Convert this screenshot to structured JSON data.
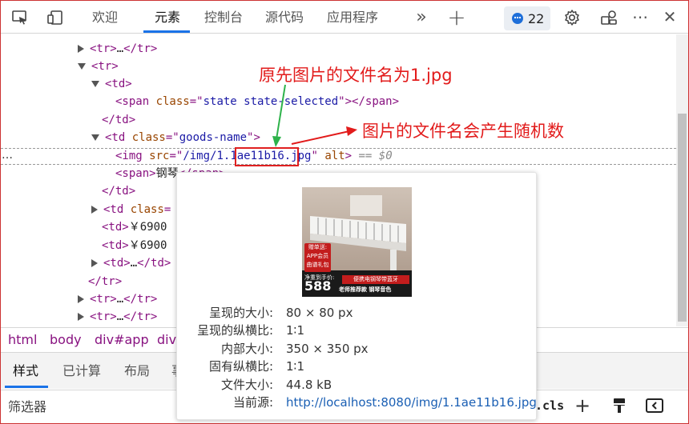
{
  "toolbar": {
    "tabs": [
      {
        "label": "欢迎"
      },
      {
        "label": "元素"
      },
      {
        "label": "控制台"
      },
      {
        "label": "源代码"
      },
      {
        "label": "应用程序"
      }
    ],
    "issues_count": "22",
    "more_tabs_glyph": "»",
    "add_glyph": "+",
    "overflow_glyph": "⋯",
    "close_glyph": "✕"
  },
  "dom_tree": {
    "lines": [
      {
        "pre": "",
        "tag_open": "<tr>",
        "mid": "…",
        "tag_close": "</tr>"
      },
      {
        "tag": "<tr>"
      },
      {
        "tag": "<td>"
      },
      {
        "tag_a": "<span ",
        "attr": "class",
        "eq": "=\"",
        "val": "state state-selected",
        "q": "\">",
        "tag_b": "</span>"
      },
      {
        "tag": "</td>"
      },
      {
        "tag_a": "<td ",
        "attr": "class",
        "eq": "=\"",
        "val": "goods-name",
        "q": "\">"
      },
      {
        "tag_a": "<img ",
        "attr": "src",
        "eq": "=\"",
        "val_a": "/img/1.",
        "val_hl": "1ae11b16",
        "val_b": ".jpg",
        "q": "\" ",
        "attr2": "alt",
        "tag_b": ">",
        "eq_dollar": " == $0"
      },
      {
        "tag_a": "<span>",
        "text": "钢琴",
        "tag_b": "</span>"
      },
      {
        "tag": "</td>"
      },
      {
        "tag_a": "<td ",
        "attr": "class",
        "eq": "="
      },
      {
        "tag_a": "<td>",
        "text": "￥6900"
      },
      {
        "tag_a": "<td>",
        "text": "￥6900"
      },
      {
        "tag_a": "<td>",
        "mid": "…",
        "tag_b": "</td>"
      },
      {
        "tag": "</tr>"
      },
      {
        "tag_a": "<tr>",
        "mid": "…",
        "tag_b": "</tr>"
      },
      {
        "tag_a": "<tr>",
        "mid": "…",
        "tag_b": "</tr>"
      }
    ],
    "row_ellipsis": "…"
  },
  "annotations": {
    "top": "原先图片的文件名为1.jpg",
    "right": "图片的文件名会产生随机数"
  },
  "breadcrumb": [
    {
      "label": "html"
    },
    {
      "label": "body"
    },
    {
      "label": "div#app"
    },
    {
      "label": "div."
    }
  ],
  "bottom_tabs": [
    {
      "label": "样式"
    },
    {
      "label": "已计算"
    },
    {
      "label": "布局"
    },
    {
      "label": "事"
    }
  ],
  "filter": {
    "label": "筛选器",
    "cls_label": ".cls"
  },
  "tooltip": {
    "thumb_text": {
      "badge": "赠单送:",
      "badge2": "APP会员",
      "badge3": "曲谱礼包",
      "price_label": "净重到手价:",
      "price": "588",
      "line1": "便携电钢琴带蓝牙",
      "line2": "老师推荐款 钢琴音色"
    },
    "rows": [
      {
        "key": "呈现的大小:",
        "value": "80 × 80 px"
      },
      {
        "key": "呈现的纵横比:",
        "value": "1∶1"
      },
      {
        "key": "内部大小:",
        "value": "350 × 350 px"
      },
      {
        "key": "固有纵横比:",
        "value": "1∶1"
      },
      {
        "key": "文件大小:",
        "value": "44.8 kB"
      },
      {
        "key": "当前源:",
        "value": "http://localhost:8080/img/1.1ae11b16.jpg"
      }
    ]
  },
  "colors": {
    "accent": "#1a73e8",
    "annotation": "#e21b1b",
    "arrow_green": "#2db24a",
    "tag": "#881280",
    "attr": "#994500",
    "attr_value": "#1a1aa6"
  }
}
